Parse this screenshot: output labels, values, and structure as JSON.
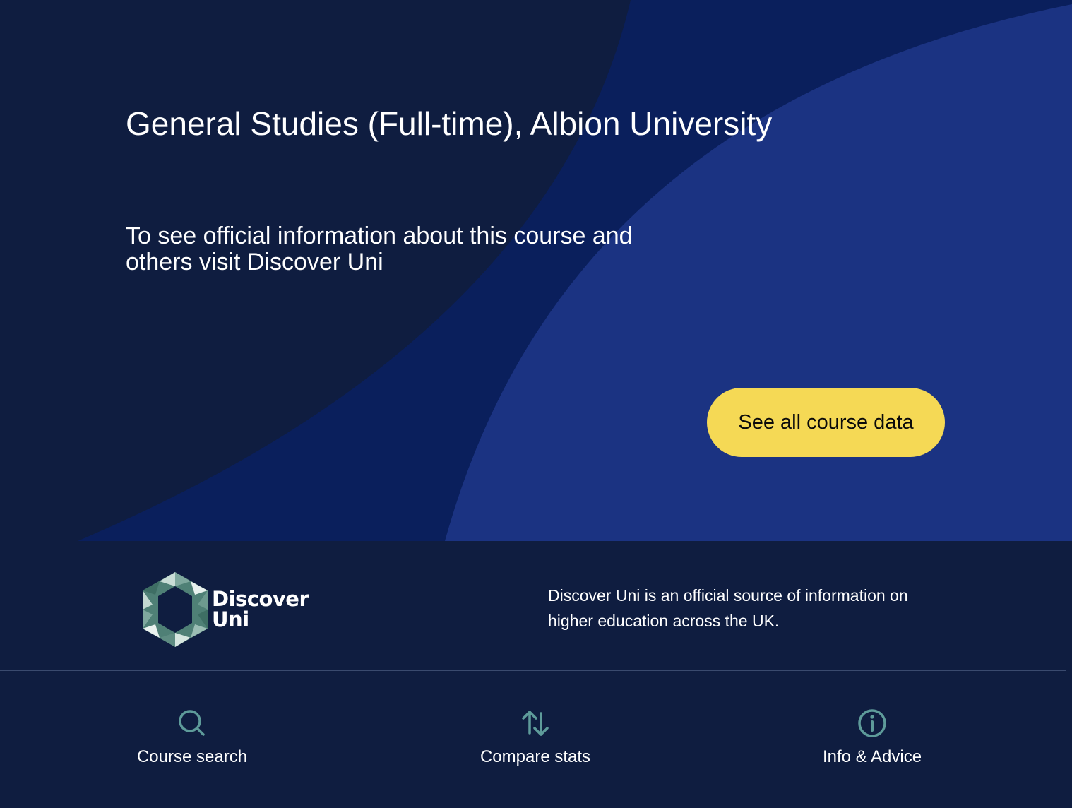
{
  "hero": {
    "title": "General Studies (Full-time), Albion University",
    "intro": "To see official information about this course and others visit Discover Uni",
    "cta_label": "See all course data"
  },
  "footer": {
    "logo": {
      "line1": "Discover",
      "line2": "Uni"
    },
    "description": "Discover Uni is an official source of information on higher education across the UK."
  },
  "nav": {
    "items": [
      {
        "label": "Course search",
        "icon": "search-icon"
      },
      {
        "label": "Compare stats",
        "icon": "compare-arrows-icon"
      },
      {
        "label": "Info & Advice",
        "icon": "info-icon"
      }
    ]
  },
  "colors": {
    "background": "#0f1d40",
    "hero_mid_blue": "#0a1f5c",
    "hero_light_blue": "#1b3382",
    "cta": "#f5d955",
    "icon_teal": "#5e9b9a"
  }
}
